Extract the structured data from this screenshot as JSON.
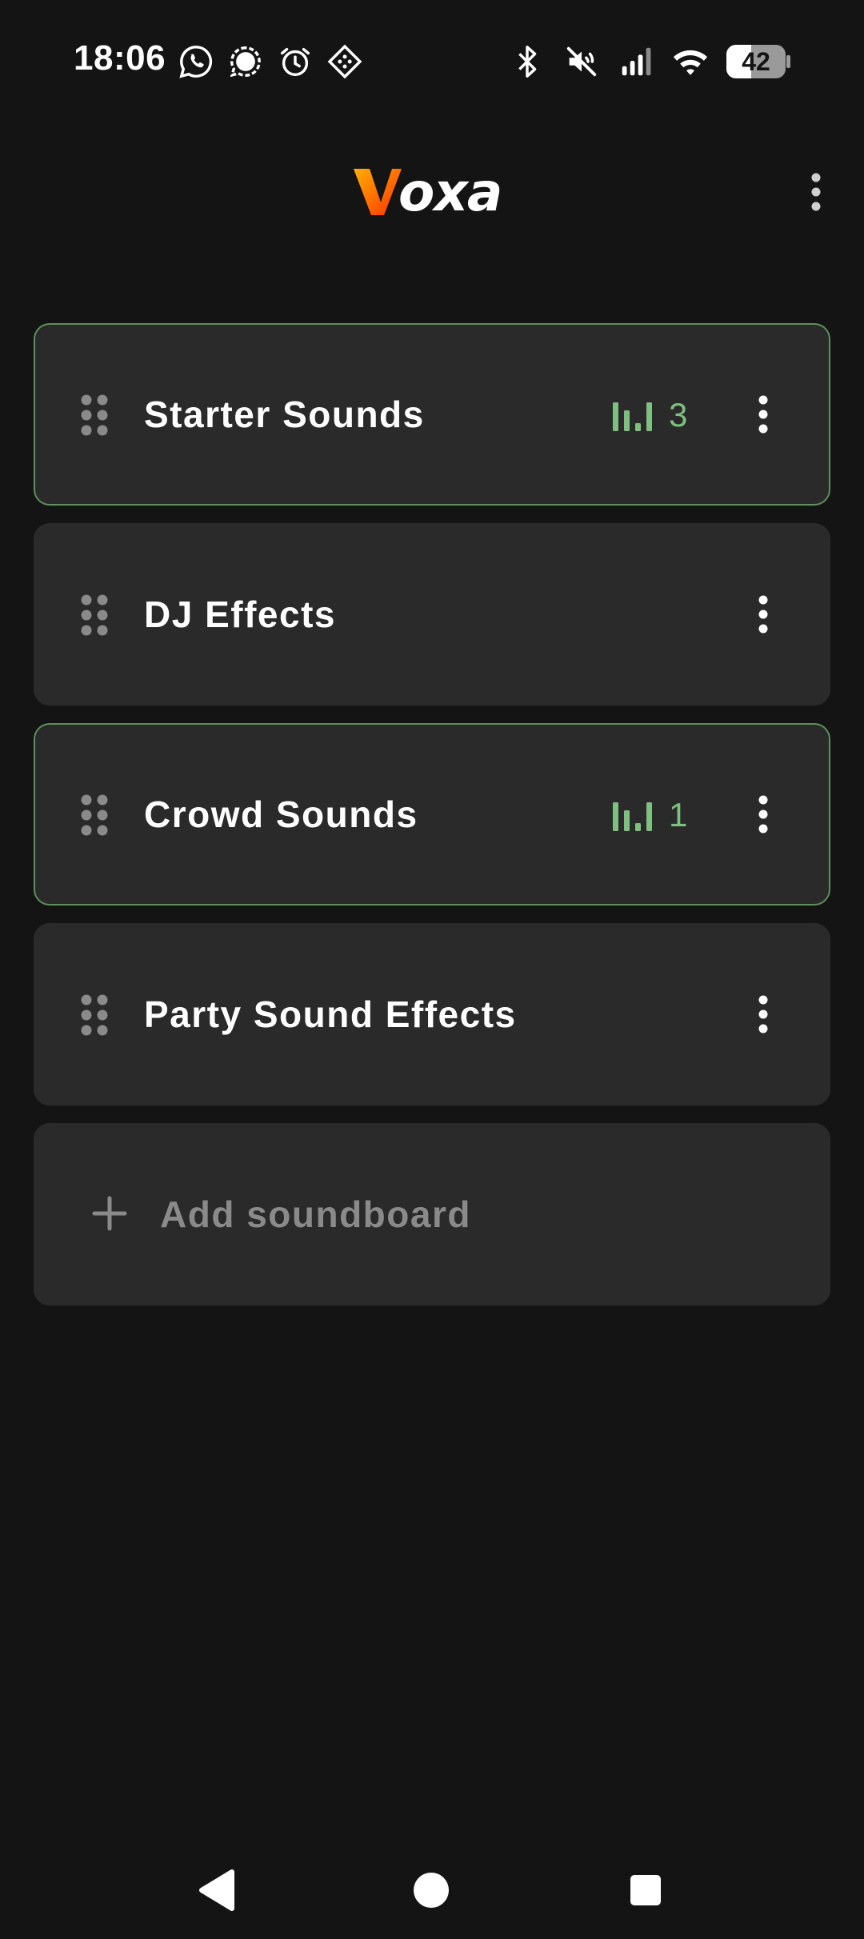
{
  "status_bar": {
    "time": "18:06",
    "left_icons": [
      "whatsapp-icon",
      "signal-icon",
      "alarm-icon",
      "app-icon"
    ],
    "right_icons": [
      "bluetooth-icon",
      "mute-icon",
      "cell-signal-icon",
      "wifi-icon"
    ],
    "battery_percent": "42",
    "battery_level": 0.42
  },
  "header": {
    "logo_first_letter": "V",
    "logo_rest": "oxa",
    "logo_colors": [
      "#ff8a00",
      "#ff3d00"
    ],
    "overflow_icon": "more-vert-icon"
  },
  "boards": [
    {
      "name": "Starter Sounds",
      "active": true,
      "playing_count": "3"
    },
    {
      "name": "DJ Effects",
      "active": false,
      "playing_count": ""
    },
    {
      "name": "Crowd Sounds",
      "active": true,
      "playing_count": "1"
    },
    {
      "name": "Party Sound Effects",
      "active": false,
      "playing_count": ""
    }
  ],
  "add_board": {
    "label": "Add soundboard",
    "icon": "plus-icon"
  },
  "colors": {
    "background": "#141414",
    "card": "#2a2a2b",
    "active_border": "#5f8e5f",
    "active_accent": "#7fbf7f",
    "muted_text": "#8a8a8a"
  },
  "nav_bar": {
    "buttons": [
      "back-icon",
      "home-icon",
      "recents-icon"
    ]
  }
}
